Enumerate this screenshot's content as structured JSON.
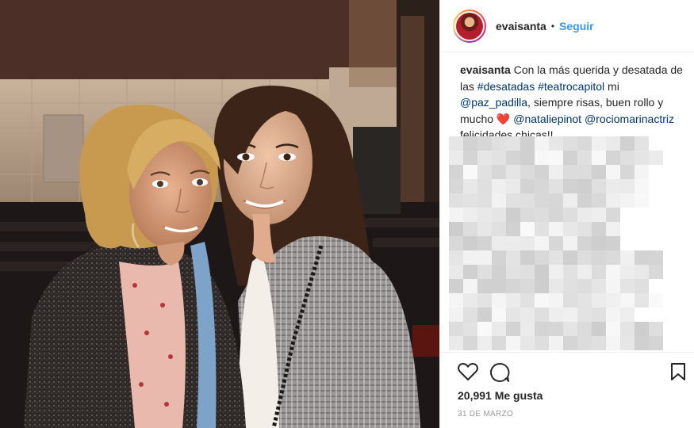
{
  "header": {
    "username": "evaisanta",
    "separator": "•",
    "follow_label": "Seguir"
  },
  "caption": {
    "username": "evaisanta",
    "text_1": "Con la más querida y desatada de las",
    "hashtag_1": "#desatadas",
    "hashtag_2": "#teatrocapitol",
    "text_2": "mi",
    "mention_1": "@paz_padilla",
    "text_3": ", siempre risas, buen rollo y mucho",
    "heart": "❤️",
    "mention_2": "@nataliepinot",
    "mention_3": "@rociomarinactriz",
    "text_4": "felicidades chicas!!"
  },
  "stats": {
    "likes": "20,991 Me gusta",
    "date": "31 DE MARZO"
  },
  "icons": {
    "like": "heart-outline-icon",
    "comment": "comment-bubble-icon",
    "save": "bookmark-icon"
  },
  "colors": {
    "link": "#003569",
    "follow": "#3897f0",
    "heart": "#ed1c24",
    "text": "#262626",
    "muted": "#999999"
  }
}
